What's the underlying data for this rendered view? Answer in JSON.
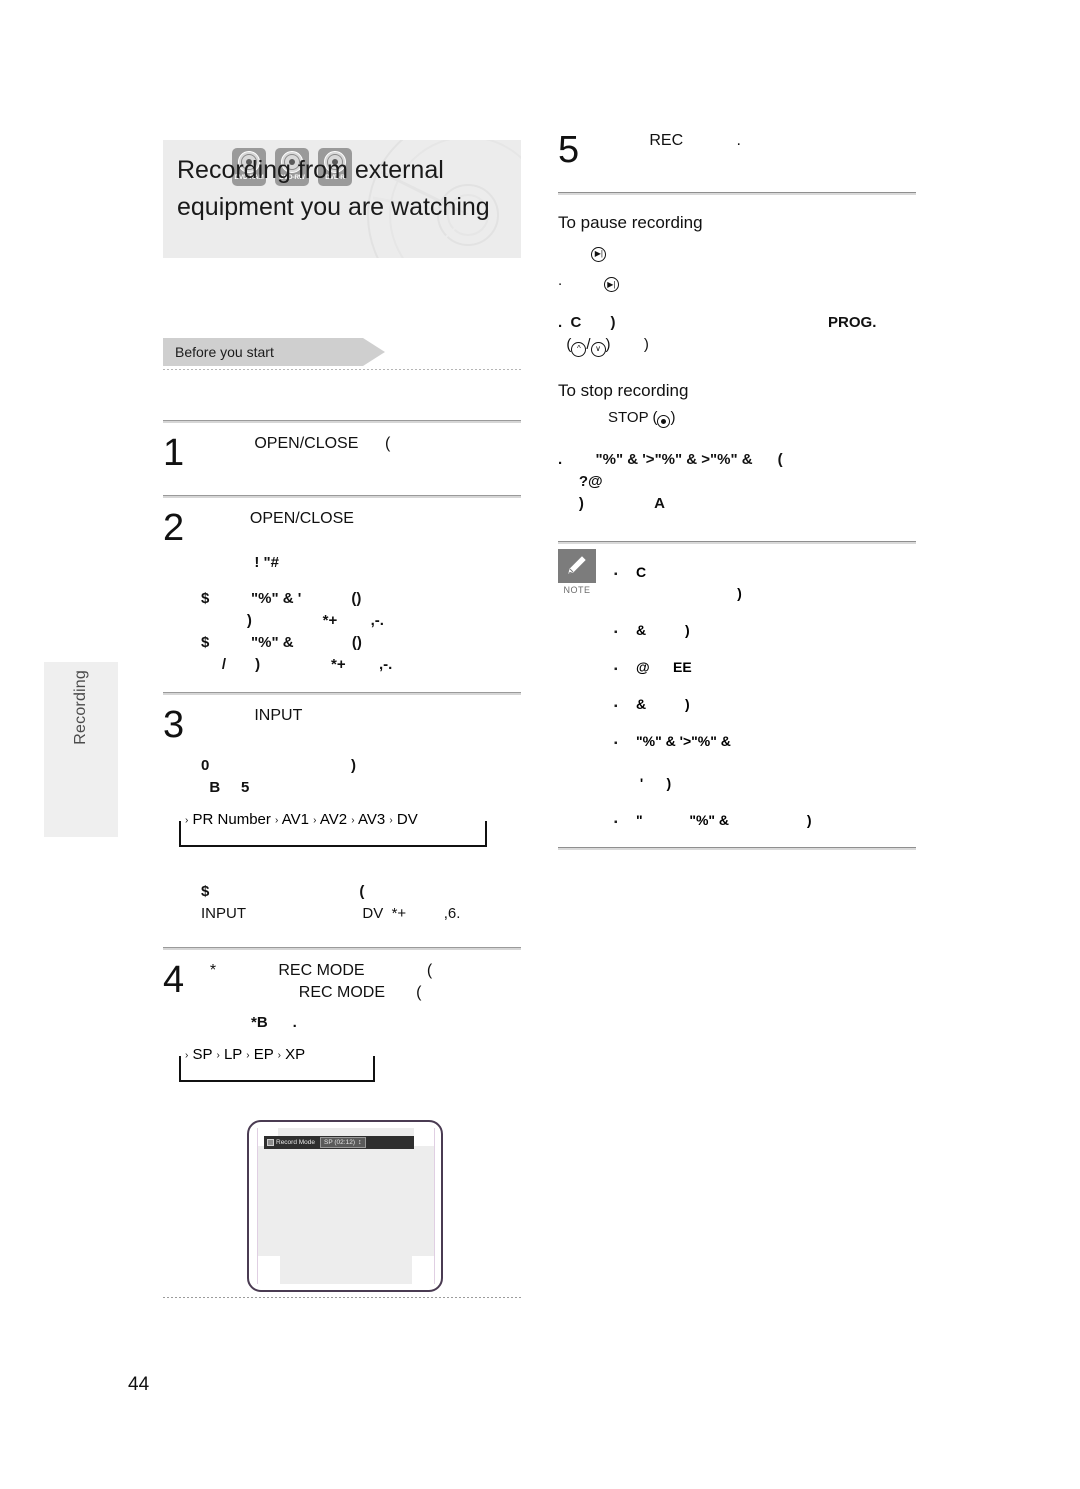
{
  "page": {
    "number": "44",
    "section_tab": "Recording"
  },
  "header": {
    "title": "Recording from external equipment you are watching",
    "disc_badges": [
      {
        "name": "DVD-RAM",
        "icon": "disc-icon"
      },
      {
        "name": "DVD-RW",
        "icon": "disc-icon"
      },
      {
        "name": "DVD-R",
        "icon": "disc-icon"
      }
    ],
    "before_you_start": "Before you start"
  },
  "left_column": {
    "steps": [
      {
        "number": "1",
        "head": "            OPEN/CLOSE      (",
        "lines": []
      },
      {
        "number": "2",
        "head": "           OPEN/CLOSE",
        "lines": [
          {
            "text": "        ! \"#",
            "style": "bold",
            "indent": 1
          },
          {
            "text": "$          \"%\" & '            ()",
            "style": "bold",
            "indent": 0
          },
          {
            "text": "           )                 *+        ,-.",
            "style": "bold",
            "indent": 0
          },
          {
            "text": "$          \"%\" &              ()",
            "style": "bold",
            "indent": 0
          },
          {
            "text": "     /       )                 *+        ,-.",
            "style": "bold",
            "indent": 0
          }
        ]
      },
      {
        "number": "3",
        "head": "            INPUT",
        "lines": [
          {
            "text": "0                                  )",
            "style": "bold",
            "indent": 0
          },
          {
            "text": "  B     5",
            "style": "bold",
            "indent": 0
          }
        ],
        "cycle": {
          "items": [
            "PR Number",
            "AV1",
            "AV2",
            "AV3",
            "DV"
          ],
          "arrow": "→"
        },
        "after_lines": [
          {
            "text": "$                                    (",
            "style": "bold",
            "indent": 0
          },
          {
            "text": "INPUT                            DV  *+         ,6.",
            "style": "regular",
            "indent": 0
          }
        ]
      },
      {
        "number": "4",
        "head": "  *              REC MODE              (",
        "head2": "                      REC MODE       (",
        "lines": [
          {
            "text": "            *B      .",
            "style": "bold",
            "indent": 1
          }
        ],
        "cycle": {
          "items": [
            "SP",
            "LP",
            "EP",
            "XP"
          ],
          "arrow": "→"
        }
      }
    ],
    "tv_mock": {
      "osd_label": "Record Mode",
      "osd_value": "SP (02:12)",
      "osd_updown": "↕"
    }
  },
  "right_column": {
    "step5": {
      "number": "5",
      "head": "            REC            ."
    },
    "pause_section": {
      "title": "To pause recording",
      "lines": [
        {
          "prefix": "        ",
          "icon": "pause-icon",
          "suffix": ""
        },
        {
          "prefix": ".          ",
          "icon": "pause-icon",
          "suffix": ""
        }
      ],
      "prog_line_1": ".  C       )                                                   PROG.",
      "prog_line_2_prefix": "  (",
      "prog_line_2_suffix": ")        )",
      "prog_up_icon": "prog-up-icon",
      "prog_down_icon": "prog-down-icon"
    },
    "stop_section": {
      "title": "To stop recording",
      "stop_label": "STOP (",
      "stop_label_end": ")",
      "stop_icon": "stop-icon",
      "lines": [
        ".        \"%\" & '>\"%\" & >\"%\" &      (",
        "     ?@",
        "     )                 A"
      ]
    },
    "note": {
      "badge": "NOTE",
      "icon": "pencil-icon",
      "items": [
        "C\n                          )",
        "&          )",
        "@      EE",
        "&          )",
        "\"%\" & '>\"%\" &\n\n '      )",
        "\"            \"%\" &                    )"
      ]
    }
  }
}
